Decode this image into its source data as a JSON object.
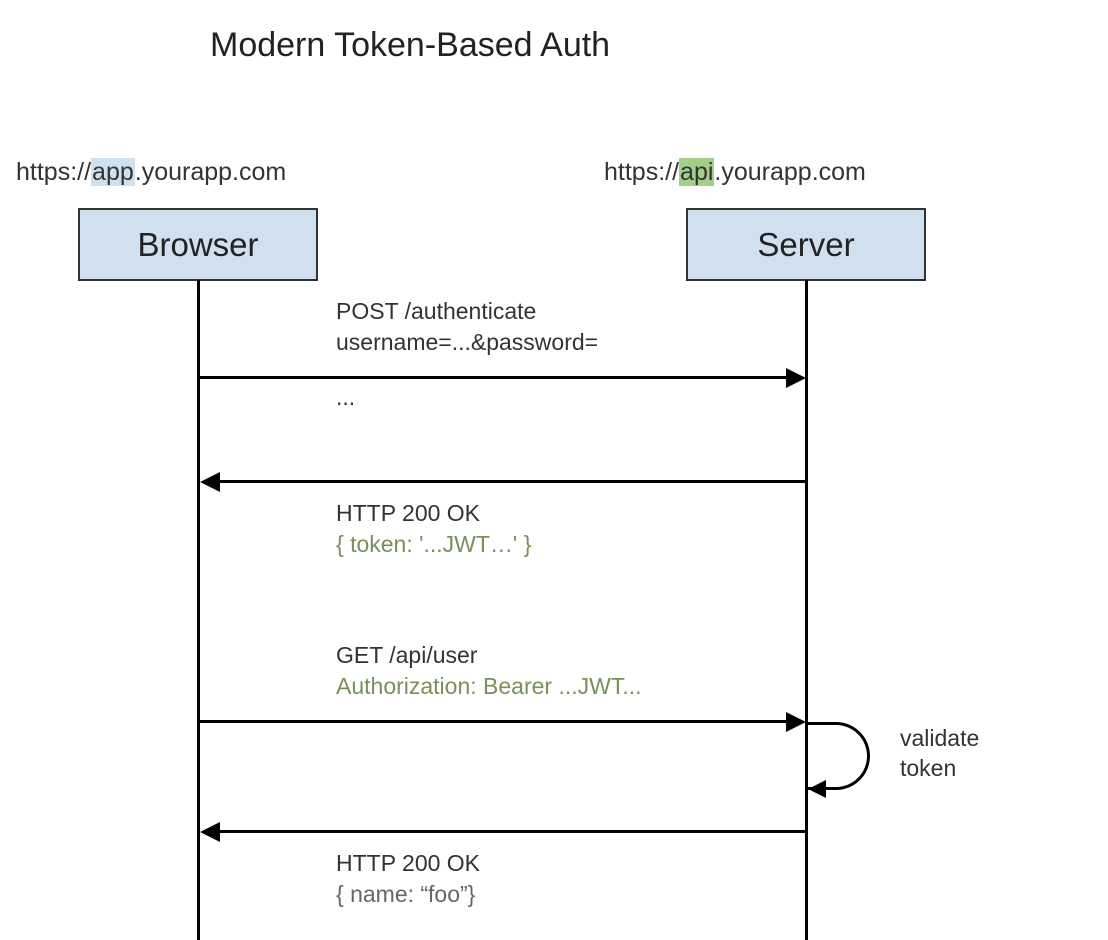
{
  "title": "Modern Token-Based Auth",
  "browser": {
    "url_pre": "https://",
    "url_hl": "app",
    "url_post": ".yourapp.com",
    "label": "Browser"
  },
  "server": {
    "url_pre": "https://",
    "url_hl": "api",
    "url_post": ".yourapp.com",
    "label": "Server"
  },
  "messages": {
    "req1_line1": "POST /authenticate",
    "req1_line2": "username=...&password=",
    "req1_line3": "...",
    "res1_line1": "HTTP 200 OK",
    "res1_line2": "{ token: '...JWT…' }",
    "req2_line1": "GET /api/user",
    "req2_line2": "Authorization: Bearer ...JWT...",
    "res2_line1": "HTTP 200 OK",
    "res2_line2": "{ name: “foo”}"
  },
  "loop": {
    "line1": "validate",
    "line2": "token"
  },
  "chart_data": {
    "type": "sequence-diagram",
    "title": "Modern Token-Based Auth",
    "participants": [
      {
        "id": "browser",
        "label": "Browser",
        "url": "https://app.yourapp.com"
      },
      {
        "id": "server",
        "label": "Server",
        "url": "https://api.yourapp.com"
      }
    ],
    "interactions": [
      {
        "from": "browser",
        "to": "server",
        "lines": [
          "POST /authenticate",
          "username=...&password=..."
        ]
      },
      {
        "from": "server",
        "to": "browser",
        "lines": [
          "HTTP 200 OK",
          "{ token: '...JWT...' }"
        ]
      },
      {
        "from": "browser",
        "to": "server",
        "lines": [
          "GET /api/user",
          "Authorization: Bearer ...JWT..."
        ]
      },
      {
        "from": "server",
        "to": "server",
        "self": true,
        "lines": [
          "validate token"
        ]
      },
      {
        "from": "server",
        "to": "browser",
        "lines": [
          "HTTP 200 OK",
          "{ name: \"foo\"}"
        ]
      }
    ]
  }
}
